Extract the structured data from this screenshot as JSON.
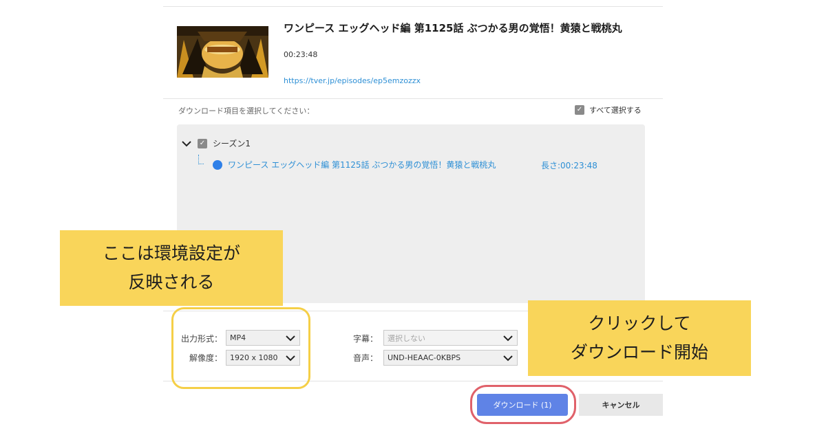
{
  "episode": {
    "title": "ワンピース エッグヘッド編 第1125話 ぶつかる男の覚悟！黄猿と戦桃丸",
    "duration": "00:23:48",
    "url": "https://tver.jp/episodes/ep5emzozzx",
    "thumbnail_icon": "episode-thumbnail-image"
  },
  "selection": {
    "prompt": "ダウンロード項目を選択してください：",
    "select_all_label": "すべて選択する",
    "select_all_checked": true
  },
  "tree": {
    "season_label": "シーズン1",
    "season_checked": true,
    "episodes": [
      {
        "title": "ワンピース エッグヘッド編 第1125話 ぶつかる男の覚悟！黄猿と戦桃丸",
        "length": "長さ:00:23:48",
        "selected": true
      }
    ]
  },
  "settings": {
    "format_label": "出力形式：",
    "format_value": "MP4",
    "resolution_label": "解像度：",
    "resolution_value": "1920 x 1080",
    "subtitle_label": "字幕：",
    "subtitle_value": "選択しない",
    "audio_label": "音声：",
    "audio_value": "UND-HEAAC-0KBPS"
  },
  "buttons": {
    "download_label": "ダウンロード (1)",
    "cancel_label": "キャンセル"
  },
  "annotations": {
    "settings_callout_line1": "ここは環境設定が",
    "settings_callout_line2": "反映される",
    "download_callout_line1": "クリックして",
    "download_callout_line2": "ダウンロード開始"
  },
  "colors": {
    "accent_blue": "#2d8fd5",
    "download_button": "#5f83e6",
    "callout_yellow": "#f9d55a",
    "ring_yellow": "#f5cf47",
    "ring_red": "#e0616a"
  }
}
